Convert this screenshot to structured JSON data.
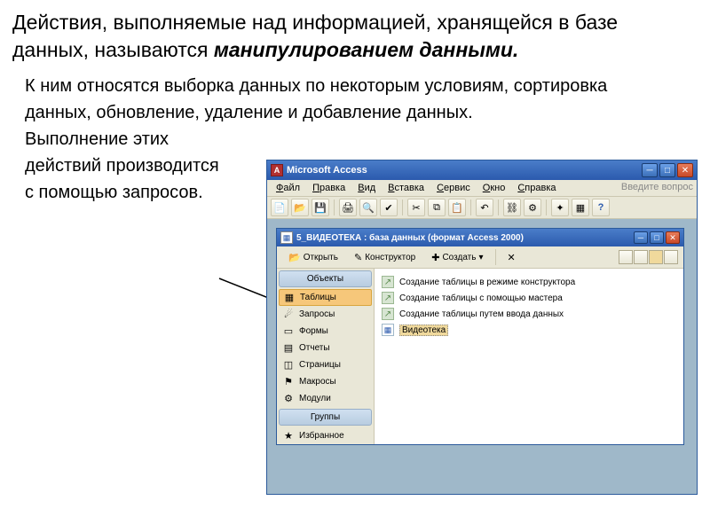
{
  "doc": {
    "heading_plain": "Действия, выполняемые над информацией, хранящейся в базе данных, называются ",
    "heading_em": "манипулированием данными.",
    "para1": "К ним относятся выборка данных по некоторым условиям, сортировка данных, обновление, удаление и добавление данных.",
    "para2a": "Выполнение этих",
    "para2b": "действий производится",
    "para2c": "с помощью запросов."
  },
  "app": {
    "title": "Microsoft Access",
    "menu": [
      "Файл",
      "Правка",
      "Вид",
      "Вставка",
      "Сервис",
      "Окно",
      "Справка"
    ],
    "help_hint": "Введите вопрос"
  },
  "db": {
    "title": "5_ВИДЕОТЕКА : база данных (формат Access 2000)",
    "toolbar": {
      "open": "Открыть",
      "design": "Конструктор",
      "create": "Создать"
    },
    "nav": {
      "objects": "Объекты",
      "groups": "Группы",
      "items": [
        {
          "icon": "▦",
          "label": "Таблицы",
          "sel": true
        },
        {
          "icon": "☄",
          "label": "Запросы"
        },
        {
          "icon": "▭",
          "label": "Формы"
        },
        {
          "icon": "▤",
          "label": "Отчеты"
        },
        {
          "icon": "◫",
          "label": "Страницы"
        },
        {
          "icon": "⚑",
          "label": "Макросы"
        },
        {
          "icon": "⚙",
          "label": "Модули"
        }
      ],
      "fav": {
        "icon": "★",
        "label": "Избранное"
      }
    },
    "content": {
      "rows": [
        {
          "type": "create",
          "label": "Создание таблицы в режиме конструктора"
        },
        {
          "type": "create",
          "label": "Создание таблицы с помощью мастера"
        },
        {
          "type": "create",
          "label": "Создание таблицы путем ввода данных"
        },
        {
          "type": "table",
          "label": "Видеотека",
          "sel": true
        }
      ]
    }
  }
}
